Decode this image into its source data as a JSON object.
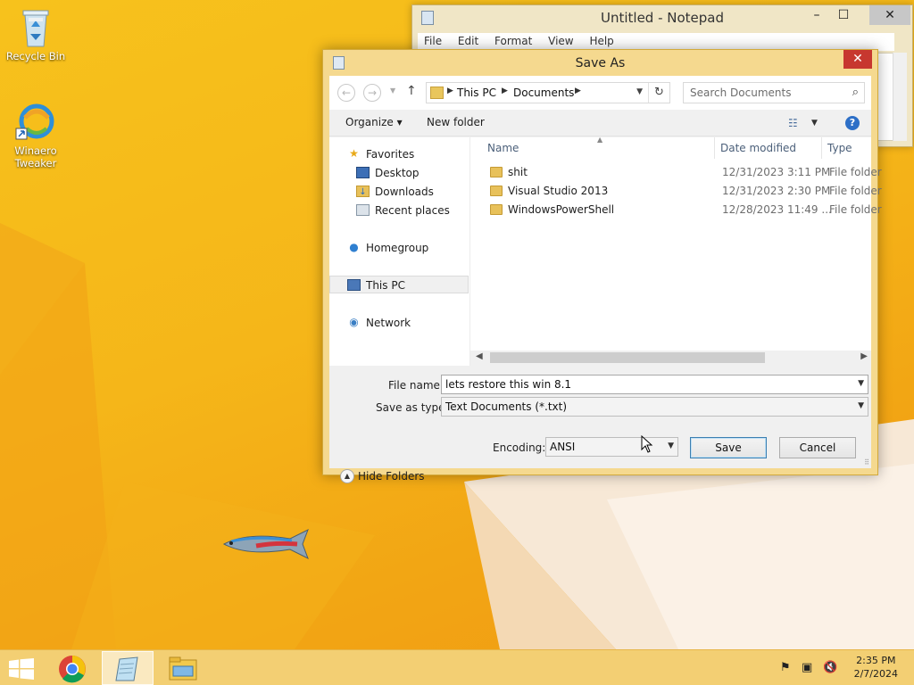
{
  "desktop": {
    "icons": [
      {
        "label": "Recycle Bin",
        "icon": "recycle-bin-icon"
      },
      {
        "label": "Winaero Tweaker",
        "icon": "winaero-tweaker-icon"
      }
    ]
  },
  "notepad": {
    "title": "Untitled - Notepad",
    "menu": [
      "File",
      "Edit",
      "Format",
      "View",
      "Help"
    ]
  },
  "save_dialog": {
    "title": "Save As",
    "address": {
      "crumbs": [
        "This PC",
        "Documents"
      ]
    },
    "search_placeholder": "Search Documents",
    "toolbar": {
      "organize": "Organize ▾",
      "new_folder": "New folder"
    },
    "nav": {
      "favorites": "Favorites",
      "desktop": "Desktop",
      "downloads": "Downloads",
      "recent": "Recent places",
      "homegroup": "Homegroup",
      "this_pc": "This PC",
      "network": "Network"
    },
    "columns": {
      "name": "Name",
      "date": "Date modified",
      "type": "Type"
    },
    "files": [
      {
        "name": "shit",
        "date": "12/31/2023 3:11 PM",
        "type": "File folder"
      },
      {
        "name": "Visual Studio 2013",
        "date": "12/31/2023 2:30 PM",
        "type": "File folder"
      },
      {
        "name": "WindowsPowerShell",
        "date": "12/28/2023 11:49 ...",
        "type": "File folder"
      }
    ],
    "form": {
      "file_name_label": "File name:",
      "file_name_value": "lets restore this win 8.1",
      "save_type_label": "Save as type:",
      "save_type_value": "Text Documents (*.txt)",
      "encoding_label": "Encoding:",
      "encoding_value": "ANSI"
    },
    "buttons": {
      "hide_folders": "Hide Folders",
      "save": "Save",
      "cancel": "Cancel"
    }
  },
  "taskbar": {
    "clock": {
      "time": "2:35 PM",
      "date": "2/7/2024"
    }
  }
}
